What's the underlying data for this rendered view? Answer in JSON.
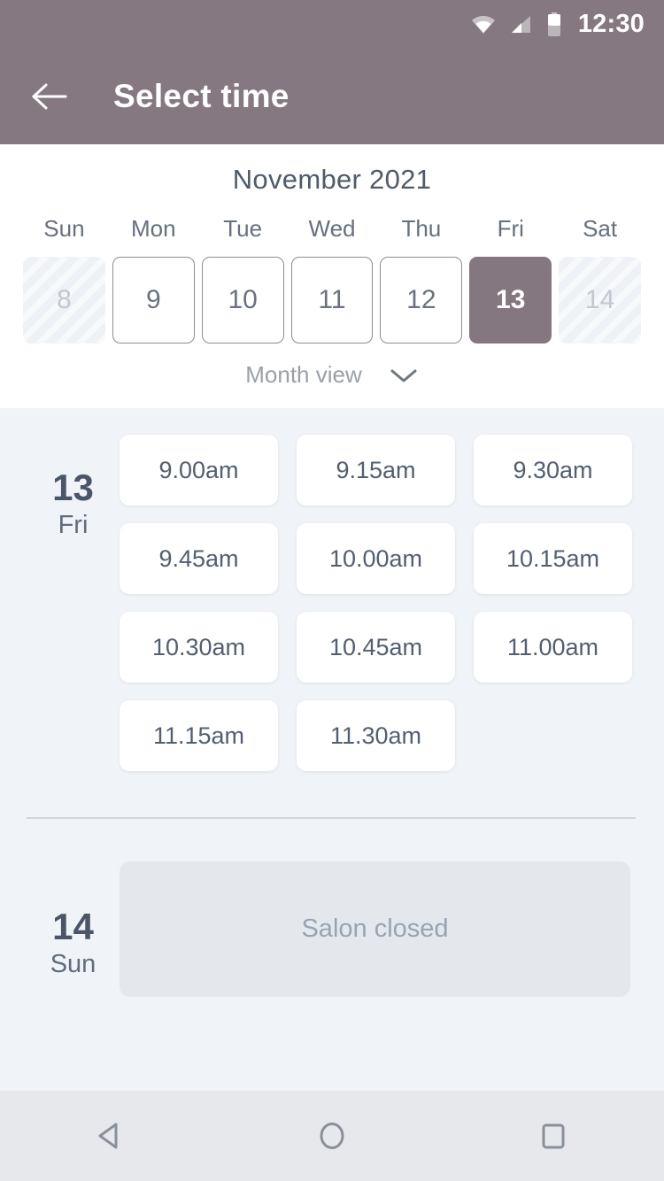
{
  "status_bar": {
    "time": "12:30",
    "icons": [
      "wifi-icon",
      "cell-signal-icon",
      "battery-icon"
    ]
  },
  "app_bar": {
    "back_icon": "arrow-left-icon",
    "title": "Select time"
  },
  "calendar": {
    "month_title": "November 2021",
    "weekday_headers": [
      "Sun",
      "Mon",
      "Tue",
      "Wed",
      "Thu",
      "Fri",
      "Sat"
    ],
    "days": [
      {
        "number": "8",
        "state": "unavailable"
      },
      {
        "number": "9",
        "state": "available"
      },
      {
        "number": "10",
        "state": "available"
      },
      {
        "number": "11",
        "state": "available"
      },
      {
        "number": "12",
        "state": "available"
      },
      {
        "number": "13",
        "state": "selected"
      },
      {
        "number": "14",
        "state": "unavailable"
      }
    ],
    "view_toggle": {
      "label": "Month view",
      "icon": "chevron-down-icon"
    }
  },
  "schedule": {
    "days": [
      {
        "date_number": "13",
        "weekday": "Fri",
        "slots": [
          "9.00am",
          "9.15am",
          "9.30am",
          "9.45am",
          "10.00am",
          "10.15am",
          "10.30am",
          "10.45am",
          "11.00am",
          "11.15am",
          "11.30am"
        ]
      },
      {
        "date_number": "14",
        "weekday": "Sun",
        "closed_message": "Salon closed"
      }
    ]
  },
  "nav_bar": {
    "buttons": [
      {
        "name": "back-nav-icon",
        "icon": "triangle-left-icon"
      },
      {
        "name": "home-nav-icon",
        "icon": "circle-icon"
      },
      {
        "name": "recents-nav-icon",
        "icon": "square-icon"
      }
    ]
  },
  "colors": {
    "header": "#857881",
    "selected_day": "#847780",
    "slot_area_bg": "#f0f3f7",
    "slot_card": "#ffffff",
    "closed_panel": "#e4e8ed",
    "text_dark": "#4a5568",
    "nav_bar": "#e6e8ec"
  }
}
